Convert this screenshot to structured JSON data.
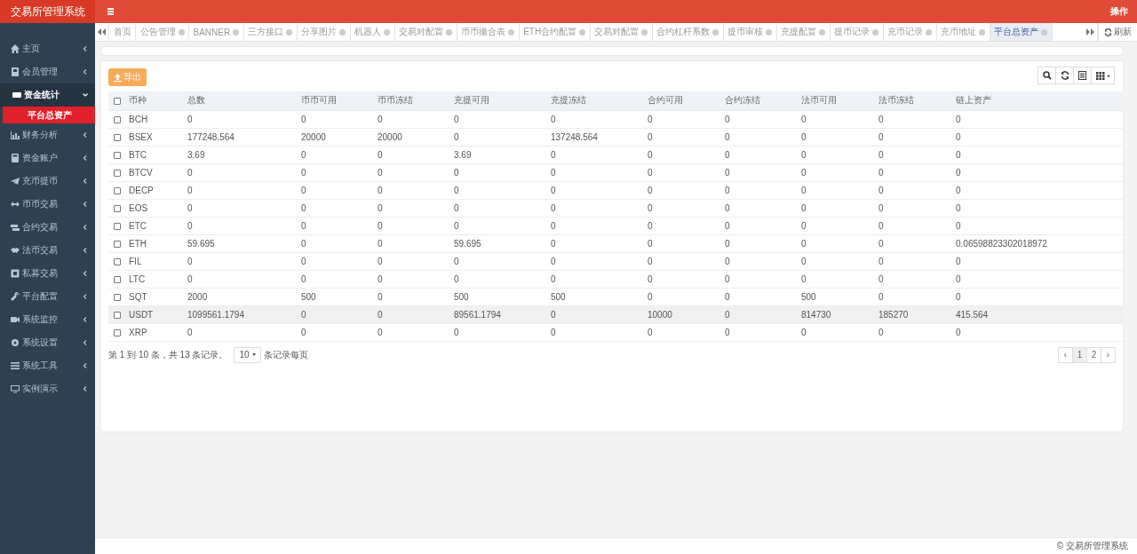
{
  "app": {
    "title": "交易所管理系统"
  },
  "header": {
    "right_label": "操作"
  },
  "sidebar": {
    "items": [
      {
        "label": "主页",
        "expanded": false
      },
      {
        "label": "会员管理",
        "expanded": false
      },
      {
        "label": "资金统计",
        "expanded": true,
        "children": [
          {
            "label": "平台总资产",
            "selected": true
          }
        ]
      },
      {
        "label": "财务分析",
        "expanded": false
      },
      {
        "label": "资金账户",
        "expanded": false
      },
      {
        "label": "充币提币",
        "expanded": false
      },
      {
        "label": "币币交易",
        "expanded": false
      },
      {
        "label": "合约交易",
        "expanded": false
      },
      {
        "label": "法币交易",
        "expanded": false
      },
      {
        "label": "私募交易",
        "expanded": false
      },
      {
        "label": "平台配置",
        "expanded": false
      },
      {
        "label": "系统监控",
        "expanded": false
      },
      {
        "label": "系统设置",
        "expanded": false
      },
      {
        "label": "系统工具",
        "expanded": false
      },
      {
        "label": "实例演示",
        "expanded": false
      }
    ]
  },
  "tabs": [
    {
      "label": "首页",
      "closable": false,
      "selected": false
    },
    {
      "label": "公告管理",
      "closable": true,
      "selected": false
    },
    {
      "label": "BANNER",
      "closable": true,
      "selected": false
    },
    {
      "label": "三方接口",
      "closable": true,
      "selected": false
    },
    {
      "label": "分享图片",
      "closable": true,
      "selected": false
    },
    {
      "label": "机器人",
      "closable": true,
      "selected": false
    },
    {
      "label": "交易对配置",
      "closable": true,
      "selected": false
    },
    {
      "label": "币币撮合表",
      "closable": true,
      "selected": false
    },
    {
      "label": "ETH合约配置",
      "closable": true,
      "selected": false
    },
    {
      "label": "交易对配置",
      "closable": true,
      "selected": false
    },
    {
      "label": "合约杠杆系数",
      "closable": true,
      "selected": false
    },
    {
      "label": "提币审核",
      "closable": true,
      "selected": false
    },
    {
      "label": "充提配置",
      "closable": true,
      "selected": false
    },
    {
      "label": "提币记录",
      "closable": true,
      "selected": false
    },
    {
      "label": "充币记录",
      "closable": true,
      "selected": false
    },
    {
      "label": "充币地址",
      "closable": true,
      "selected": false
    },
    {
      "label": "平台总资产",
      "closable": true,
      "selected": true
    }
  ],
  "refresh_label": "刷新",
  "toolbar": {
    "export_label": "导出"
  },
  "table": {
    "select_all_checked": false,
    "columns": [
      "币种",
      "总数",
      "币币可用",
      "币币冻结",
      "充提可用",
      "充提冻结",
      "合约可用",
      "合约冻结",
      "法币可用",
      "法币冻结",
      "链上资产"
    ],
    "rows": [
      {
        "checked": false,
        "hovered": false,
        "cells": [
          "BCH",
          "0",
          "0",
          "0",
          "0",
          "0",
          "0",
          "0",
          "0",
          "0",
          "0"
        ]
      },
      {
        "checked": false,
        "hovered": false,
        "cells": [
          "BSEX",
          "177248.564",
          "20000",
          "20000",
          "0",
          "137248.564",
          "0",
          "0",
          "0",
          "0",
          "0"
        ]
      },
      {
        "checked": false,
        "hovered": false,
        "cells": [
          "BTC",
          "3.69",
          "0",
          "0",
          "3.69",
          "0",
          "0",
          "0",
          "0",
          "0",
          "0"
        ]
      },
      {
        "checked": false,
        "hovered": false,
        "cells": [
          "BTCV",
          "0",
          "0",
          "0",
          "0",
          "0",
          "0",
          "0",
          "0",
          "0",
          "0"
        ]
      },
      {
        "checked": false,
        "hovered": false,
        "cells": [
          "DECP",
          "0",
          "0",
          "0",
          "0",
          "0",
          "0",
          "0",
          "0",
          "0",
          "0"
        ]
      },
      {
        "checked": false,
        "hovered": false,
        "cells": [
          "EOS",
          "0",
          "0",
          "0",
          "0",
          "0",
          "0",
          "0",
          "0",
          "0",
          "0"
        ]
      },
      {
        "checked": false,
        "hovered": false,
        "cells": [
          "ETC",
          "0",
          "0",
          "0",
          "0",
          "0",
          "0",
          "0",
          "0",
          "0",
          "0"
        ]
      },
      {
        "checked": false,
        "hovered": false,
        "cells": [
          "ETH",
          "59.695",
          "0",
          "0",
          "59.695",
          "0",
          "0",
          "0",
          "0",
          "0",
          "0.06598823302018972"
        ]
      },
      {
        "checked": false,
        "hovered": false,
        "cells": [
          "FIL",
          "0",
          "0",
          "0",
          "0",
          "0",
          "0",
          "0",
          "0",
          "0",
          "0"
        ]
      },
      {
        "checked": false,
        "hovered": false,
        "cells": [
          "LTC",
          "0",
          "0",
          "0",
          "0",
          "0",
          "0",
          "0",
          "0",
          "0",
          "0"
        ]
      },
      {
        "checked": false,
        "hovered": false,
        "cells": [
          "SQT",
          "2000",
          "500",
          "0",
          "500",
          "500",
          "0",
          "0",
          "500",
          "0",
          "0"
        ]
      },
      {
        "checked": false,
        "hovered": true,
        "cells": [
          "USDT",
          "1099561.1794",
          "0",
          "0",
          "89561.1794",
          "0",
          "10000",
          "0",
          "814730",
          "185270",
          "415.564"
        ]
      },
      {
        "checked": false,
        "hovered": false,
        "cells": [
          "XRP",
          "0",
          "0",
          "0",
          "0",
          "0",
          "0",
          "0",
          "0",
          "0",
          "0"
        ]
      }
    ]
  },
  "pagination": {
    "summary": "第 1 到 10 条，共 13 条记录。",
    "page_size": "10",
    "page_size_suffix": "条记录每页",
    "prev": "‹",
    "pages": [
      {
        "label": "1",
        "selected": true
      },
      {
        "label": "2",
        "selected": false
      }
    ],
    "next": "›"
  },
  "footer": {
    "text": "© 交易所管理系统"
  }
}
